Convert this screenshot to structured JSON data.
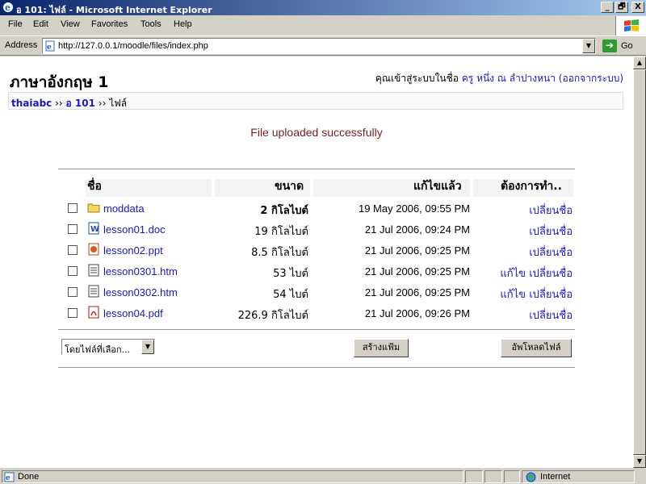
{
  "window": {
    "title": "อ 101: ไฟล์ - Microsoft Internet Explorer",
    "minimize": "_",
    "maximize": "🗗",
    "close": "X"
  },
  "menu": [
    "File",
    "Edit",
    "View",
    "Favorites",
    "Tools",
    "Help"
  ],
  "address": {
    "label": "Address",
    "url": "http://127.0.0.1/moodle/files/index.php",
    "go_label": "Go"
  },
  "page": {
    "course_title": "ภาษาอังกฤษ 1",
    "login_prefix": "คุณเข้าสู่ระบบในชื่อ",
    "login_user": "ครู หนึ่ง ณ ลำปางหนา",
    "logout_link": "(ออกจากระบบ)",
    "breadcrumb": {
      "site": "thaiabc",
      "sep1": " ›› ",
      "course": "อ 101",
      "sep2": " ›› ",
      "current": "ไฟล์"
    },
    "notification": "File uploaded successfully",
    "columns": {
      "name": "ชื่อ",
      "size": "ขนาด",
      "modified": "แก้ไขแล้ว",
      "action": "ต้องการทำ.."
    },
    "files": [
      {
        "name": "moddata",
        "icon": "folder-icon",
        "size": "2 กิโลไบต์",
        "modified": "19 May 2006, 09:55 PM",
        "edit": "",
        "rename": "เปลี่ยนชื่อ"
      },
      {
        "name": "lesson01.doc",
        "icon": "word-doc-icon",
        "size": "19 กิโลไบต์",
        "modified": "21 Jul 2006, 09:24 PM",
        "edit": "",
        "rename": "เปลี่ยนชื่อ"
      },
      {
        "name": "lesson02.ppt",
        "icon": "powerpoint-icon",
        "size": "8.5 กิโลไบต์",
        "modified": "21 Jul 2006, 09:25 PM",
        "edit": "",
        "rename": "เปลี่ยนชื่อ"
      },
      {
        "name": "lesson0301.htm",
        "icon": "html-file-icon",
        "size": "53 ไบต์",
        "modified": "21 Jul 2006, 09:25 PM",
        "edit": "แก้ไข",
        "rename": "เปลี่ยนชื่อ"
      },
      {
        "name": "lesson0302.htm",
        "icon": "html-file-icon",
        "size": "54 ไบต์",
        "modified": "21 Jul 2006, 09:25 PM",
        "edit": "แก้ไข",
        "rename": "เปลี่ยนชื่อ"
      },
      {
        "name": "lesson04.pdf",
        "icon": "pdf-icon",
        "size": "226.9 กิโลไบต์",
        "modified": "21 Jul 2006, 09:26 PM",
        "edit": "",
        "rename": "เปลี่ยนชื่อ"
      }
    ],
    "bulk_select": "โดยไฟล์ที่เลือก...",
    "make_folder": "สร้างแฟ้ม",
    "upload_file": "อัพโหลดไฟล์"
  },
  "status": {
    "text": "Done",
    "zone": "Internet"
  },
  "colors": {
    "link": "#1a1ab8",
    "notify": "#7a2020",
    "titlebar": "#0a246a"
  }
}
